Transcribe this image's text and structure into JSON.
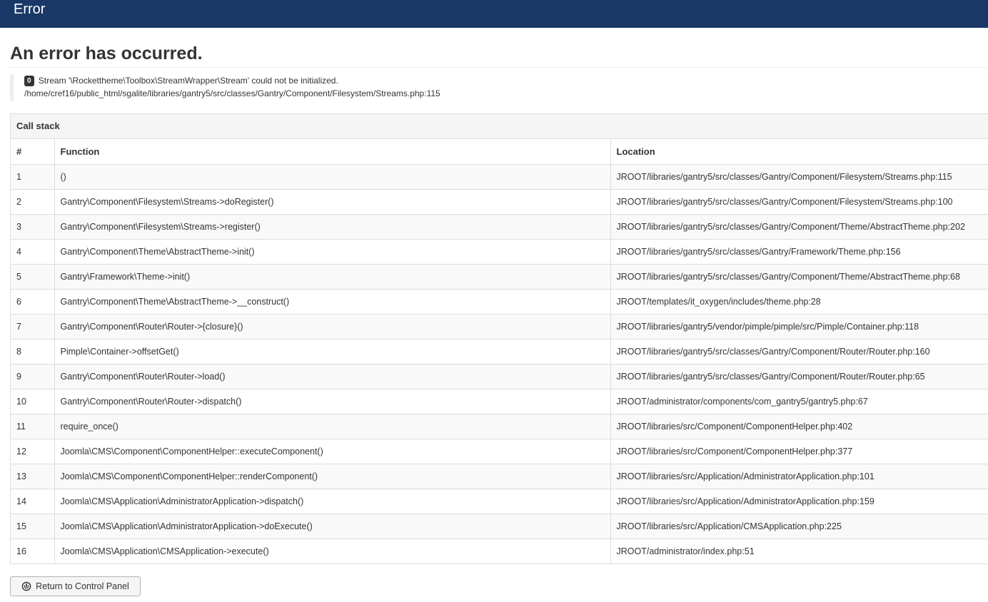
{
  "header": {
    "title": "Error"
  },
  "page": {
    "heading": "An error has occurred."
  },
  "error": {
    "code": "0",
    "message": "Stream '\\Rockettheme\\Toolbox\\StreamWrapper\\Stream' could not be initialized.",
    "path": "/home/cref16/public_html/sgalite/libraries/gantry5/src/classes/Gantry/Component/Filesystem/Streams.php:115"
  },
  "call_stack": {
    "title": "Call stack",
    "columns": {
      "num": "#",
      "function": "Function",
      "location": "Location"
    },
    "rows": [
      {
        "num": "1",
        "function": "()",
        "location": "JROOT/libraries/gantry5/src/classes/Gantry/Component/Filesystem/Streams.php:115"
      },
      {
        "num": "2",
        "function": "Gantry\\Component\\Filesystem\\Streams->doRegister()",
        "location": "JROOT/libraries/gantry5/src/classes/Gantry/Component/Filesystem/Streams.php:100"
      },
      {
        "num": "3",
        "function": "Gantry\\Component\\Filesystem\\Streams->register()",
        "location": "JROOT/libraries/gantry5/src/classes/Gantry/Component/Theme/AbstractTheme.php:202"
      },
      {
        "num": "4",
        "function": "Gantry\\Component\\Theme\\AbstractTheme->init()",
        "location": "JROOT/libraries/gantry5/src/classes/Gantry/Framework/Theme.php:156"
      },
      {
        "num": "5",
        "function": "Gantry\\Framework\\Theme->init()",
        "location": "JROOT/libraries/gantry5/src/classes/Gantry/Component/Theme/AbstractTheme.php:68"
      },
      {
        "num": "6",
        "function": "Gantry\\Component\\Theme\\AbstractTheme->__construct()",
        "location": "JROOT/templates/it_oxygen/includes/theme.php:28"
      },
      {
        "num": "7",
        "function": "Gantry\\Component\\Router\\Router->{closure}()",
        "location": "JROOT/libraries/gantry5/vendor/pimple/pimple/src/Pimple/Container.php:118"
      },
      {
        "num": "8",
        "function": "Pimple\\Container->offsetGet()",
        "location": "JROOT/libraries/gantry5/src/classes/Gantry/Component/Router/Router.php:160"
      },
      {
        "num": "9",
        "function": "Gantry\\Component\\Router\\Router->load()",
        "location": "JROOT/libraries/gantry5/src/classes/Gantry/Component/Router/Router.php:65"
      },
      {
        "num": "10",
        "function": "Gantry\\Component\\Router\\Router->dispatch()",
        "location": "JROOT/administrator/components/com_gantry5/gantry5.php:67"
      },
      {
        "num": "11",
        "function": "require_once()",
        "location": "JROOT/libraries/src/Component/ComponentHelper.php:402"
      },
      {
        "num": "12",
        "function": "Joomla\\CMS\\Component\\ComponentHelper::executeComponent()",
        "location": "JROOT/libraries/src/Component/ComponentHelper.php:377"
      },
      {
        "num": "13",
        "function": "Joomla\\CMS\\Component\\ComponentHelper::renderComponent()",
        "location": "JROOT/libraries/src/Application/AdministratorApplication.php:101"
      },
      {
        "num": "14",
        "function": "Joomla\\CMS\\Application\\AdministratorApplication->dispatch()",
        "location": "JROOT/libraries/src/Application/AdministratorApplication.php:159"
      },
      {
        "num": "15",
        "function": "Joomla\\CMS\\Application\\AdministratorApplication->doExecute()",
        "location": "JROOT/libraries/src/Application/CMSApplication.php:225"
      },
      {
        "num": "16",
        "function": "Joomla\\CMS\\Application\\CMSApplication->execute()",
        "location": "JROOT/administrator/index.php:51"
      }
    ]
  },
  "actions": {
    "return_label": "Return to Control Panel",
    "return_icon": "power-icon"
  },
  "colors": {
    "header_bg": "#1a3867",
    "header_text": "#ffffff",
    "striped_row": "#f9f9f9",
    "border": "#dddddd"
  }
}
